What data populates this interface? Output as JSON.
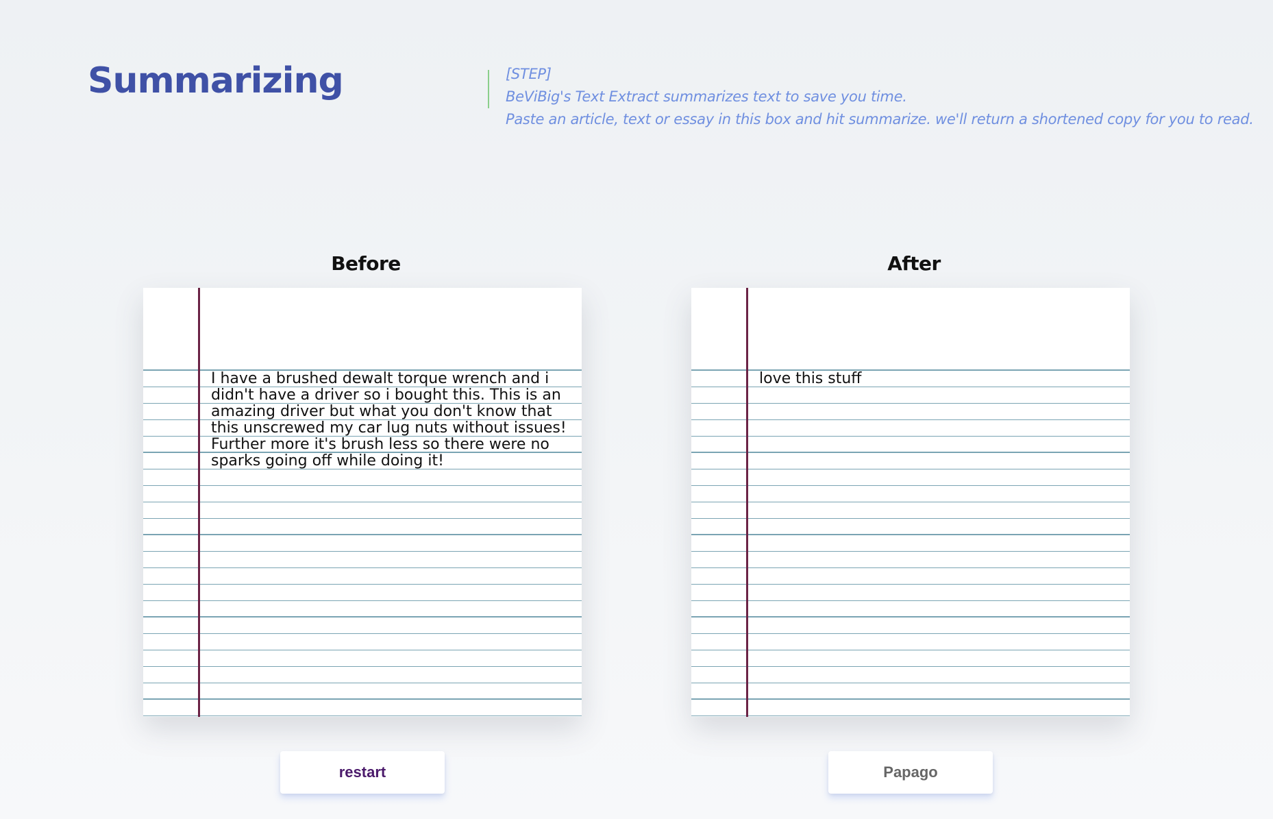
{
  "page": {
    "title": "Summarizing"
  },
  "step": {
    "tag": "[STEP]",
    "line1": "BeViBig's Text Extract summarizes text to save you time.",
    "line2": "Paste an article, text or essay in this box and hit summarize. we'll return a shortened copy for you to read."
  },
  "before": {
    "heading": "Before",
    "text": "I have a brushed dewalt torque wrench and i didn't have a driver so i bought this. This is an amazing driver but what you don't know that this unscrewed my car lug nuts without issues! Further more it's brush less so there were no sparks going off while doing it!"
  },
  "after": {
    "heading": "After",
    "text": "love this stuff"
  },
  "buttons": {
    "restart_label": "restart",
    "papago_label": "Papago"
  },
  "colors": {
    "title": "#3f51a6",
    "step_text": "#6f8fe0",
    "step_accent": "#8bcf8b",
    "margin_line": "#6b2346",
    "ruled_line": "#7aa4b3",
    "restart_text": "#4b1a6b"
  }
}
